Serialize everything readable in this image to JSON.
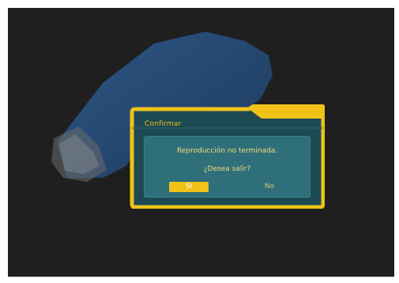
{
  "dialog": {
    "title": "Confirmar",
    "message": "Reproducción no terminada.",
    "question": "¿Desea salir?",
    "buttons": {
      "yes_label": "SI",
      "no_label": "No"
    }
  },
  "colors": {
    "screen_background": "#1f1f1f",
    "dialog_border": "#f0c21a",
    "dialog_background": "#1d4a52",
    "message_box": "#2f6f7a",
    "selected_button": "#f0c21a"
  }
}
